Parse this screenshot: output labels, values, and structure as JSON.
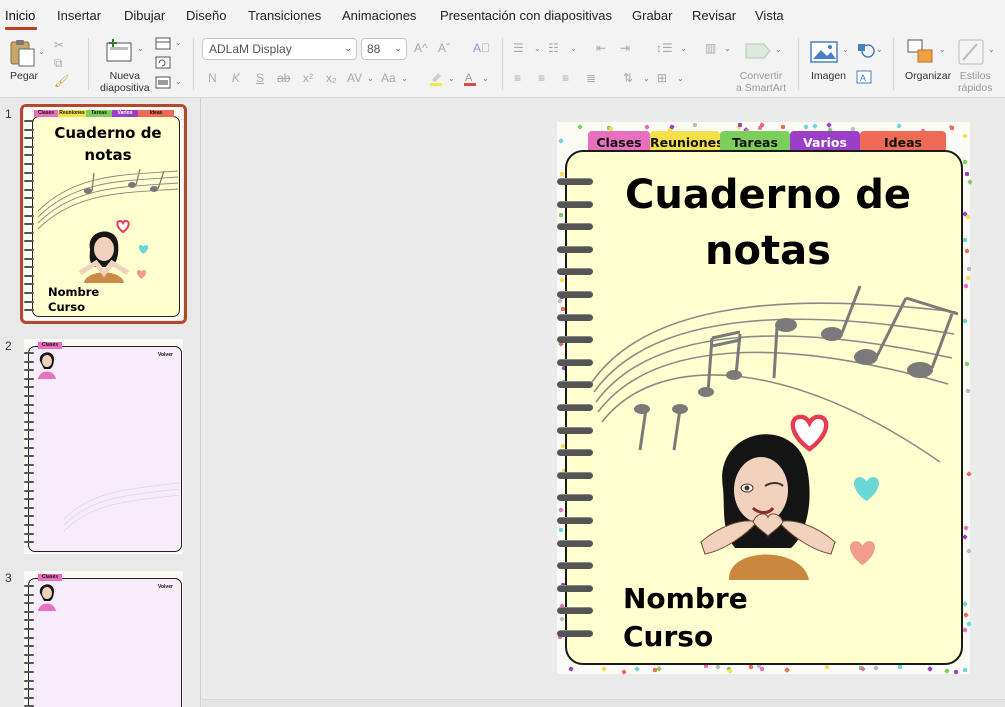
{
  "menu": {
    "tabs": [
      "Inicio",
      "Insertar",
      "Dibujar",
      "Diseño",
      "Transiciones",
      "Animaciones",
      "Presentación con diapositivas",
      "Grabar",
      "Revisar",
      "Vista"
    ]
  },
  "ribbon": {
    "paste_label": "Pegar",
    "new_slide_label_1": "Nueva",
    "new_slide_label_2": "diapositiva",
    "font_name": "ADLaM Display",
    "font_size": "88",
    "bold_glyph": "N",
    "italic_glyph": "K",
    "underline_glyph": "S",
    "strike_glyph": "ab",
    "superscript_glyph": "x²",
    "subscript_glyph": "x₂",
    "spacing_glyph": "AV",
    "case_glyph": "Aa",
    "smartart_label_1": "Convertir",
    "smartart_label_2": "a SmartArt",
    "image_label": "Imagen",
    "arrange_label": "Organizar",
    "styles_label_1": "Estilos",
    "styles_label_2": "rápidos"
  },
  "thumbnails": [
    {
      "number": "1",
      "title": "Cuaderno de notas",
      "name_line1": "Nombre",
      "name_line2": "Curso",
      "tabs": [
        "Clases",
        "Reuniones",
        "Tareas",
        "Varios",
        "Ideas"
      ]
    },
    {
      "number": "2",
      "tab": "Clases",
      "back": "Volver"
    },
    {
      "number": "3",
      "tab": "Clases",
      "back": "Volver"
    }
  ],
  "slide": {
    "tabs": [
      {
        "label": "Clases",
        "color": "#e86fbd"
      },
      {
        "label": "Reuniones",
        "color": "#f4e04a"
      },
      {
        "label": "Tareas",
        "color": "#7ccf5c"
      },
      {
        "label": "Varios",
        "color": "#9b3fc9"
      },
      {
        "label": "Ideas",
        "color": "#ee6a55"
      }
    ],
    "title_line1": "Cuaderno de",
    "title_line2": "notas",
    "name_line1": "Nombre",
    "name_line2": "Curso"
  },
  "colors": {
    "accent": "#c43e1c",
    "notebook_bg": "#ffffcf",
    "thumb_page_bg": "#f6ecfa"
  }
}
